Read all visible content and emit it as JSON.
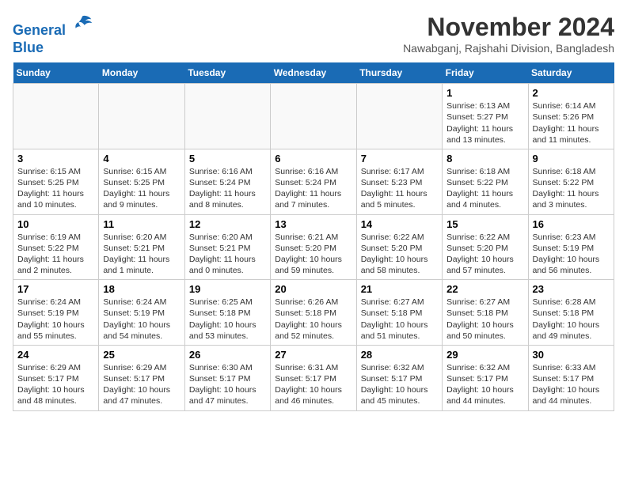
{
  "header": {
    "logo_line1": "General",
    "logo_line2": "Blue",
    "month_year": "November 2024",
    "location": "Nawabganj, Rajshahi Division, Bangladesh"
  },
  "days_of_week": [
    "Sunday",
    "Monday",
    "Tuesday",
    "Wednesday",
    "Thursday",
    "Friday",
    "Saturday"
  ],
  "weeks": [
    [
      {
        "day": "",
        "info": ""
      },
      {
        "day": "",
        "info": ""
      },
      {
        "day": "",
        "info": ""
      },
      {
        "day": "",
        "info": ""
      },
      {
        "day": "",
        "info": ""
      },
      {
        "day": "1",
        "info": "Sunrise: 6:13 AM\nSunset: 5:27 PM\nDaylight: 11 hours and 13 minutes."
      },
      {
        "day": "2",
        "info": "Sunrise: 6:14 AM\nSunset: 5:26 PM\nDaylight: 11 hours and 11 minutes."
      }
    ],
    [
      {
        "day": "3",
        "info": "Sunrise: 6:15 AM\nSunset: 5:25 PM\nDaylight: 11 hours and 10 minutes."
      },
      {
        "day": "4",
        "info": "Sunrise: 6:15 AM\nSunset: 5:25 PM\nDaylight: 11 hours and 9 minutes."
      },
      {
        "day": "5",
        "info": "Sunrise: 6:16 AM\nSunset: 5:24 PM\nDaylight: 11 hours and 8 minutes."
      },
      {
        "day": "6",
        "info": "Sunrise: 6:16 AM\nSunset: 5:24 PM\nDaylight: 11 hours and 7 minutes."
      },
      {
        "day": "7",
        "info": "Sunrise: 6:17 AM\nSunset: 5:23 PM\nDaylight: 11 hours and 5 minutes."
      },
      {
        "day": "8",
        "info": "Sunrise: 6:18 AM\nSunset: 5:22 PM\nDaylight: 11 hours and 4 minutes."
      },
      {
        "day": "9",
        "info": "Sunrise: 6:18 AM\nSunset: 5:22 PM\nDaylight: 11 hours and 3 minutes."
      }
    ],
    [
      {
        "day": "10",
        "info": "Sunrise: 6:19 AM\nSunset: 5:22 PM\nDaylight: 11 hours and 2 minutes."
      },
      {
        "day": "11",
        "info": "Sunrise: 6:20 AM\nSunset: 5:21 PM\nDaylight: 11 hours and 1 minute."
      },
      {
        "day": "12",
        "info": "Sunrise: 6:20 AM\nSunset: 5:21 PM\nDaylight: 11 hours and 0 minutes."
      },
      {
        "day": "13",
        "info": "Sunrise: 6:21 AM\nSunset: 5:20 PM\nDaylight: 10 hours and 59 minutes."
      },
      {
        "day": "14",
        "info": "Sunrise: 6:22 AM\nSunset: 5:20 PM\nDaylight: 10 hours and 58 minutes."
      },
      {
        "day": "15",
        "info": "Sunrise: 6:22 AM\nSunset: 5:20 PM\nDaylight: 10 hours and 57 minutes."
      },
      {
        "day": "16",
        "info": "Sunrise: 6:23 AM\nSunset: 5:19 PM\nDaylight: 10 hours and 56 minutes."
      }
    ],
    [
      {
        "day": "17",
        "info": "Sunrise: 6:24 AM\nSunset: 5:19 PM\nDaylight: 10 hours and 55 minutes."
      },
      {
        "day": "18",
        "info": "Sunrise: 6:24 AM\nSunset: 5:19 PM\nDaylight: 10 hours and 54 minutes."
      },
      {
        "day": "19",
        "info": "Sunrise: 6:25 AM\nSunset: 5:18 PM\nDaylight: 10 hours and 53 minutes."
      },
      {
        "day": "20",
        "info": "Sunrise: 6:26 AM\nSunset: 5:18 PM\nDaylight: 10 hours and 52 minutes."
      },
      {
        "day": "21",
        "info": "Sunrise: 6:27 AM\nSunset: 5:18 PM\nDaylight: 10 hours and 51 minutes."
      },
      {
        "day": "22",
        "info": "Sunrise: 6:27 AM\nSunset: 5:18 PM\nDaylight: 10 hours and 50 minutes."
      },
      {
        "day": "23",
        "info": "Sunrise: 6:28 AM\nSunset: 5:18 PM\nDaylight: 10 hours and 49 minutes."
      }
    ],
    [
      {
        "day": "24",
        "info": "Sunrise: 6:29 AM\nSunset: 5:17 PM\nDaylight: 10 hours and 48 minutes."
      },
      {
        "day": "25",
        "info": "Sunrise: 6:29 AM\nSunset: 5:17 PM\nDaylight: 10 hours and 47 minutes."
      },
      {
        "day": "26",
        "info": "Sunrise: 6:30 AM\nSunset: 5:17 PM\nDaylight: 10 hours and 47 minutes."
      },
      {
        "day": "27",
        "info": "Sunrise: 6:31 AM\nSunset: 5:17 PM\nDaylight: 10 hours and 46 minutes."
      },
      {
        "day": "28",
        "info": "Sunrise: 6:32 AM\nSunset: 5:17 PM\nDaylight: 10 hours and 45 minutes."
      },
      {
        "day": "29",
        "info": "Sunrise: 6:32 AM\nSunset: 5:17 PM\nDaylight: 10 hours and 44 minutes."
      },
      {
        "day": "30",
        "info": "Sunrise: 6:33 AM\nSunset: 5:17 PM\nDaylight: 10 hours and 44 minutes."
      }
    ]
  ]
}
